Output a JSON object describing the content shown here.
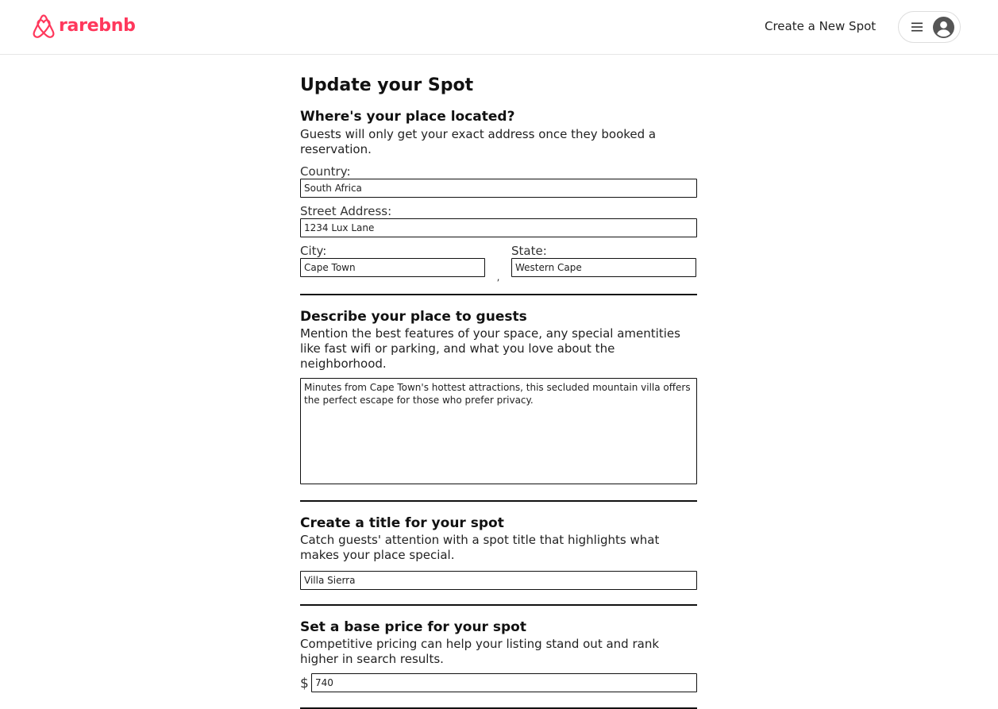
{
  "header": {
    "brand": "rarebnb",
    "create_link": "Create a New Spot",
    "menu_icon": "hamburger-icon",
    "avatar_icon": "user-circle-icon",
    "brand_color": "#ff385c"
  },
  "form": {
    "title": "Update your Spot",
    "location": {
      "heading": "Where's your place located?",
      "description": "Guests will only get your exact address once they booked a reservation.",
      "country_label": "Country:",
      "country_value": "South Africa",
      "street_label": "Street Address:",
      "street_value": "1234 Lux Lane",
      "city_label": "City:",
      "city_value": "Cape Town",
      "separator": ",",
      "state_label": "State:",
      "state_value": "Western Cape"
    },
    "describe": {
      "heading": "Describe your place to guests",
      "description": "Mention the best features of your space, any special amentities like fast wifi or parking, and what you love about the neighborhood.",
      "value": "Minutes from Cape Town's hottest attractions, this secluded mountain villa offers the perfect escape for those who prefer privacy."
    },
    "title_section": {
      "heading": "Create a title for your spot",
      "description": "Catch guests' attention with a spot title that highlights what makes your place special.",
      "value": "Villa Sierra"
    },
    "price": {
      "heading": "Set a base price for your spot",
      "description": "Competitive pricing can help your listing stand out and rank higher in search results.",
      "currency": "$",
      "value": "740"
    }
  }
}
